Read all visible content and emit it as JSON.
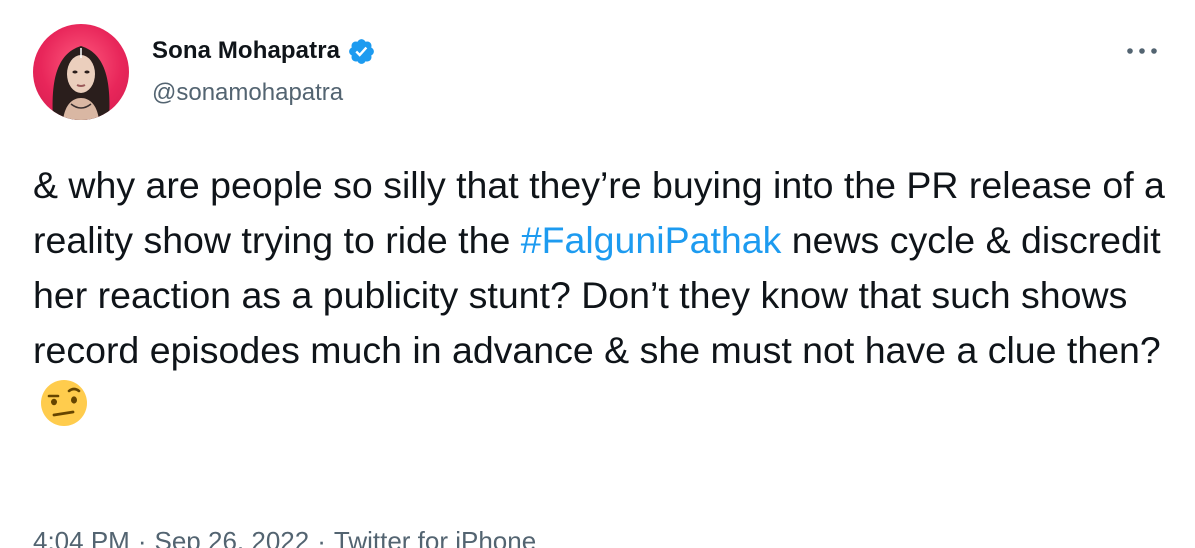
{
  "author": {
    "display_name": "Sona Mohapatra",
    "handle": "@sonamohapatra",
    "verified": true
  },
  "tweet": {
    "text_part1": "& why are people so silly that they’re buying into the PR release of a reality show trying to ride the ",
    "hashtag": "#FalguniPathak",
    "text_part2": " news cycle & discredit her reaction as a publicity stunt? Don’t they know that such shows record episodes much in advance & she must not have a clue then?",
    "emoji": "face-with-raised-eyebrow-emoji"
  },
  "meta": {
    "time": "4:04 PM",
    "date": "Sep 26, 2022",
    "source": "Twitter for iPhone",
    "separator": "·"
  },
  "colors": {
    "accent": "#1d9bf0",
    "text": "#0f1419",
    "secondary": "#536471",
    "avatar_bg": "#e8265a"
  },
  "icons": {
    "verified": "verified-badge-icon",
    "more": "more-options-icon"
  }
}
